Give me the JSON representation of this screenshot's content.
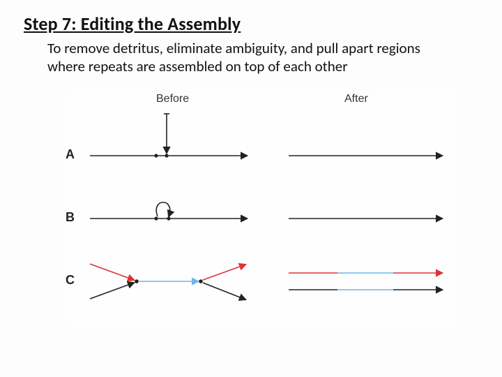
{
  "title": "Step 7: Editing the Assembly",
  "body": "To remove detritus, eliminate ambiguity, and pull apart regions where repeats are assembled on top of each other",
  "figure": {
    "cols": {
      "before": "Before",
      "after": "After"
    },
    "rows": {
      "a": "A",
      "b": "B",
      "c": "C"
    }
  }
}
